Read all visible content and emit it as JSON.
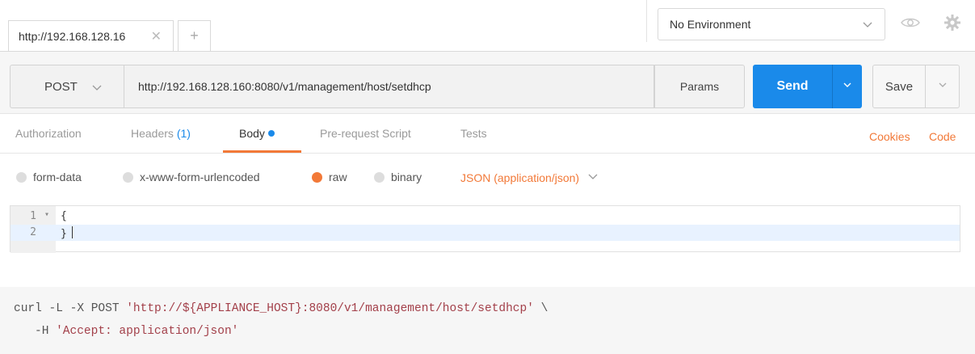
{
  "tabbar": {
    "tab_title": "http://192.168.128.16",
    "close_glyph": "✕",
    "new_tab_glyph": "+"
  },
  "environment": {
    "selected": "No Environment"
  },
  "request": {
    "method": "POST",
    "url": "http://192.168.128.160:8080/v1/management/host/setdhcp",
    "params_label": "Params",
    "send_label": "Send",
    "save_label": "Save"
  },
  "subtabs": {
    "authorization": "Authorization",
    "headers": "Headers",
    "headers_count": "(1)",
    "body": "Body",
    "prerequest": "Pre-request Script",
    "tests": "Tests",
    "cookies": "Cookies",
    "code": "Code"
  },
  "body_types": {
    "form_data": "form-data",
    "urlencoded": "x-www-form-urlencoded",
    "raw": "raw",
    "binary": "binary",
    "raw_format": "JSON (application/json)"
  },
  "editor": {
    "lines": [
      {
        "num": "1",
        "code": "{"
      },
      {
        "num": "2",
        "code": "}"
      }
    ]
  },
  "curl": {
    "cmd1": "curl -L -X POST ",
    "url_str": "'http://${APPLIANCE_HOST}:8080/v1/management/host/setdhcp'",
    "cont": " \\",
    "cmd2": "-H ",
    "header_str": "'Accept: application/json'"
  },
  "colors": {
    "accent_orange": "#f27938",
    "send_blue": "#1a8aea",
    "string_red": "#a3404a"
  },
  "icons": [
    "close-icon",
    "plus-icon",
    "chevron-down-icon",
    "eye-icon",
    "gear-icon",
    "fold-arrow-icon"
  ]
}
